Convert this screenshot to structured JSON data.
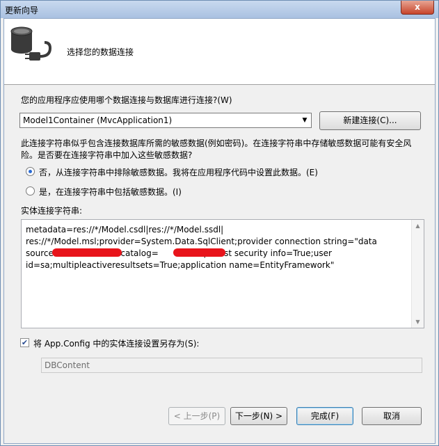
{
  "window": {
    "title": "更新向导",
    "close_glyph": "x"
  },
  "banner": {
    "title": "选择您的数据连接",
    "icon": "database-connection-icon"
  },
  "connection": {
    "question": "您的应用程序应使用哪个数据连接与数据库进行连接?(W)",
    "selected": "Model1Container (MvcApplication1)",
    "new_connection_label": "新建连接(C)..."
  },
  "sensitive": {
    "warning": "此连接字符串似乎包含连接数据库所需的敏感数据(例如密码)。在连接字符串中存储敏感数据可能有安全风险。是否要在连接字符串中加入这些敏感数据?",
    "option_no": "否，从连接字符串中排除敏感数据。我将在应用程序代码中设置此数据。(E)",
    "option_yes": "是，在连接字符串中包括敏感数据。(I)",
    "selected": "no"
  },
  "entity_string": {
    "label": "实体连接字符串:",
    "line1": "metadata=res://*/Model.csdl|res://*/Model.ssdl|",
    "line2": "res://*/Model.msl;provider=System.Data.SqlClient;provider connection string=\"data",
    "line3": "source=                  ial catalog=                 persist security info=True;user",
    "line4": "id=sa;multipleactiveresultsets=True;application name=EntityFramework\""
  },
  "save": {
    "checked": true,
    "label": "将 App.Config 中的实体连接设置另存为(S):",
    "value": "DBContent"
  },
  "footer": {
    "prev": "< 上一步(P)",
    "next": "下一步(N) >",
    "finish": "完成(F)",
    "cancel": "取消"
  },
  "colors": {
    "redaction": "#e8141b",
    "title_bar": "#b9cde8",
    "close_button": "#c7442b"
  }
}
